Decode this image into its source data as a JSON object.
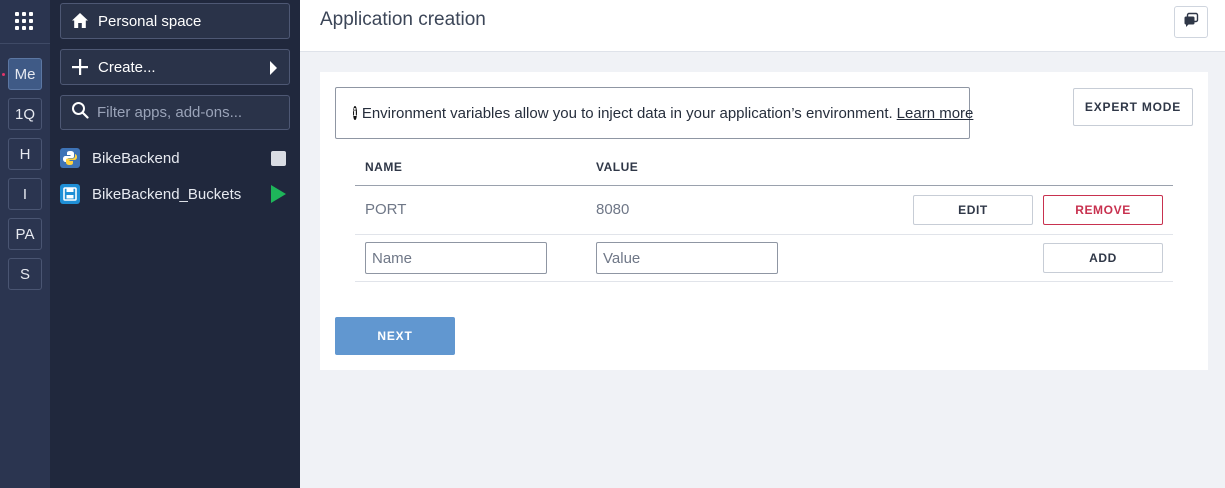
{
  "rail": {
    "orgs": [
      "Me",
      "1Q",
      "H",
      "I",
      "PA",
      "S"
    ]
  },
  "sidebar": {
    "personal_space": "Personal space",
    "create": "Create...",
    "filter_placeholder": "Filter apps, add-ons...",
    "apps": [
      {
        "name": "BikeBackend",
        "icon": "python-icon",
        "state": "stopped"
      },
      {
        "name": "BikeBackend_Buckets",
        "icon": "bucket-icon",
        "state": "running"
      }
    ]
  },
  "header": {
    "title": "Application creation"
  },
  "env": {
    "info_text": "Environment variables allow you to inject data in your application’s environment.",
    "learn_more": "Learn more",
    "expert_mode": "EXPERT MODE",
    "col_name": "NAME",
    "col_value": "VALUE",
    "rows": [
      {
        "name": "PORT",
        "value": "8080"
      }
    ],
    "edit_label": "EDIT",
    "remove_label": "REMOVE",
    "name_placeholder": "Name",
    "value_placeholder": "Value",
    "add_label": "ADD",
    "next_label": "NEXT"
  },
  "colors": {
    "rail_bg": "#2b3550",
    "sidebar_bg": "#20283d",
    "primary": "#6197d0",
    "danger": "#c8314f",
    "running": "#1eb55a"
  }
}
